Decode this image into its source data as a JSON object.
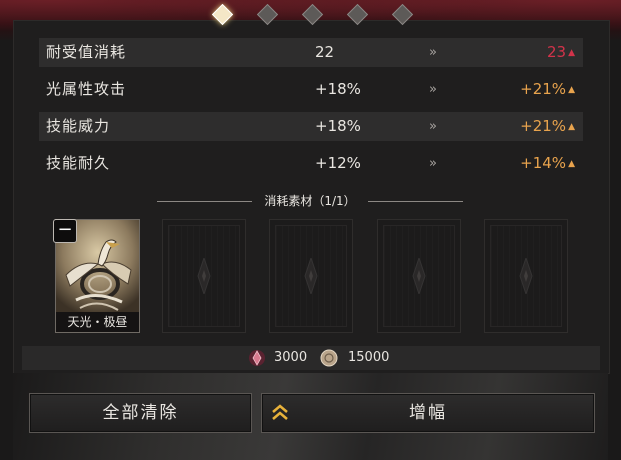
{
  "page_indicator": {
    "total": 5,
    "active_index": 0
  },
  "stats": [
    {
      "name": "耐受值消耗",
      "current": "22",
      "new": "23",
      "new_color": "#d2334a"
    },
    {
      "name": "光属性攻击",
      "current": "+18%",
      "new": "+21%",
      "new_color": "#e8a34d"
    },
    {
      "name": "技能威力",
      "current": "+18%",
      "new": "+21%",
      "new_color": "#e8a34d"
    },
    {
      "name": "技能耐久",
      "current": "+12%",
      "new": "+14%",
      "new_color": "#e8a34d"
    }
  ],
  "materials": {
    "title": "消耗素材（1/1）",
    "selected_card": {
      "name": "天光・极昼"
    },
    "empty_slots": 4
  },
  "cost": {
    "item_a": "3000",
    "item_b": "15000"
  },
  "buttons": {
    "clear_label": "全部清除",
    "amplify_label": "增幅"
  },
  "colors": {
    "gold_up": "#e8a34d",
    "red_up": "#d2334a",
    "active_dot": "#f4e7c7"
  }
}
